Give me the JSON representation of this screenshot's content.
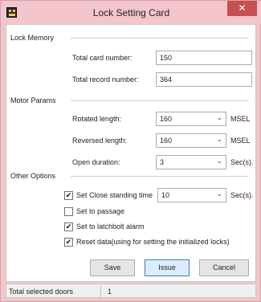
{
  "window": {
    "title": "Lock Setting Card",
    "close_glyph": "✕",
    "app_icon": "card-reader-icon",
    "colors": {
      "titlebar": "#f3c5cd",
      "close": "#c75050",
      "default_button_border": "#3c7fb1"
    }
  },
  "lock_memory": {
    "group_label": "Lock Memory",
    "total_card_label": "Total card number:",
    "total_card_value": "150",
    "total_record_label": "Total record number:",
    "total_record_value": "364"
  },
  "motor_params": {
    "group_label": "Motor Params",
    "rotated_label": "Rotated length:",
    "rotated_value": "160",
    "rotated_unit": "MSEL",
    "reversed_label": "Reversed length:",
    "reversed_value": "160",
    "reversed_unit": "MSEL",
    "open_label": "Open duration:",
    "open_value": "3",
    "open_unit": "Sec(s)."
  },
  "other_options": {
    "group_label": "Other Options",
    "close_standing": {
      "label": "Set Close standing time",
      "checked": true,
      "value": "10",
      "unit": "Sec(s)."
    },
    "passage": {
      "label": "Set to passage",
      "checked": false
    },
    "latchbolt": {
      "label": "Set to latchbolt alarm",
      "checked": true
    },
    "reset": {
      "label": "Reset data(using for setting the initialized locks)",
      "checked": true
    }
  },
  "buttons": {
    "save": "Save",
    "issue": "Issue",
    "cancel": "Cancel"
  },
  "status": {
    "label": "Total selected doors",
    "value": "1"
  },
  "glyphs": {
    "chevron": "⌄",
    "check": "✔"
  }
}
